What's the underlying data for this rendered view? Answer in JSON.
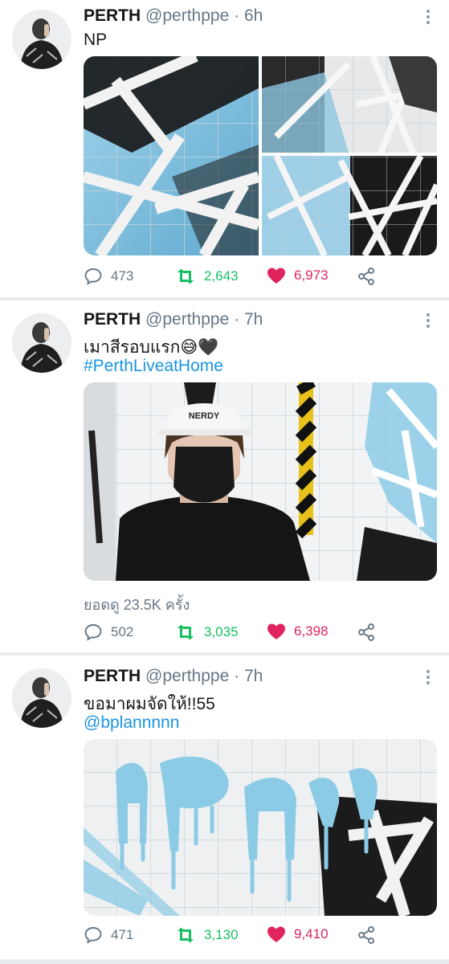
{
  "tweets": [
    {
      "name": "PERTH",
      "handle": "@perthppe",
      "dot": "·",
      "time": "6h",
      "text": "NP",
      "hashtag": "",
      "views": "",
      "reply_count": "473",
      "retweet_count": "2,643",
      "like_count": "6,973"
    },
    {
      "name": "PERTH",
      "handle": "@perthppe",
      "dot": "·",
      "time": "7h",
      "text": "เมาสีรอบแรก😅🖤",
      "hashtag": "#PerthLiveatHome",
      "views": "ยอดดู 23.5K ครั้ง",
      "reply_count": "502",
      "retweet_count": "3,035",
      "like_count": "6,398"
    },
    {
      "name": "PERTH",
      "handle": "@perthppe",
      "dot": "·",
      "time": "7h",
      "text": "ขอมาผมจัดให้!!55",
      "hashtag": "@bplannnnn",
      "views": "",
      "reply_count": "471",
      "retweet_count": "3,130",
      "like_count": "9,410"
    }
  ],
  "video": {
    "cap_text": "NERDY"
  },
  "icons": {
    "reply": "reply-icon",
    "retweet": "retweet-icon",
    "like": "heart-icon",
    "share": "share-icon",
    "more": "more-vertical-icon"
  },
  "colors": {
    "retweet": "#17bf63",
    "like": "#e0245e",
    "link": "#1b95e0",
    "muted": "#657786",
    "paint_blue": "#8ccbe6"
  }
}
